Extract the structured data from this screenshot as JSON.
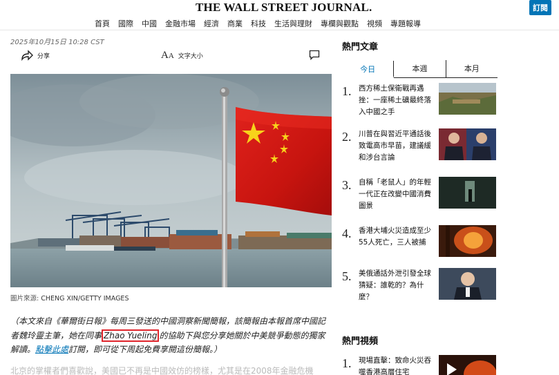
{
  "header": {
    "logo": "THE WALL STREET JOURNAL.",
    "nav": [
      "首頁",
      "國際",
      "中國",
      "金融市場",
      "經濟",
      "商業",
      "科技",
      "生活與理財",
      "專欄與觀點",
      "視頻",
      "專題報導"
    ],
    "subscribe": "訂閱"
  },
  "article": {
    "dateline": "2025年10月15日 10:28 CST",
    "share_label": "分享",
    "fontsize_label": "文字大小",
    "photo_caption_prefix": "圖片來源:",
    "photo_caption_credit": "CHENG XIN/GETTY IMAGES",
    "lede_part1": "（本文來自《華爾街日報》每周三發送的中國洞察新聞簡報，該簡報由本報首席中國記者魏玲靈主筆，她在同事",
    "lede_highlight": "Zhao Yueling",
    "lede_part2": "的協助下與您分享她關於中美競爭動態的獨家解讀。",
    "lede_link": "點擊此處",
    "lede_part3": "訂閱，即可從下周起免費享閱這份簡報。）",
    "body_faded": "北京的掌權者們喜歡說，美國已不再是中國效仿的榜樣，尤其是在2008年金融危機"
  },
  "sidebar": {
    "popular_title": "熱門文章",
    "tabs": [
      "今日",
      "本週",
      "本月"
    ],
    "active_tab": "今日",
    "popular": [
      {
        "num": "1.",
        "text": "西方稀土保衛戰再遇挫：一座稀土礦最終落入中國之手"
      },
      {
        "num": "2.",
        "text": "川普在與習近平通話後致電高市早苗，建議緩和涉台言論"
      },
      {
        "num": "3.",
        "text": "自稱「老鼠人」的年輕一代正在改變中國消費圖景"
      },
      {
        "num": "4.",
        "text": "香港大埔火災造成至少55人死亡，三人被捕"
      },
      {
        "num": "5.",
        "text": "美俄通話外泄引發全球猜疑：誰乾的？為什麼？"
      }
    ],
    "video_title": "熱門視頻",
    "videos": [
      {
        "num": "1.",
        "text": "現場直擊：致命火災吞噬香港高層住宅"
      }
    ]
  }
}
